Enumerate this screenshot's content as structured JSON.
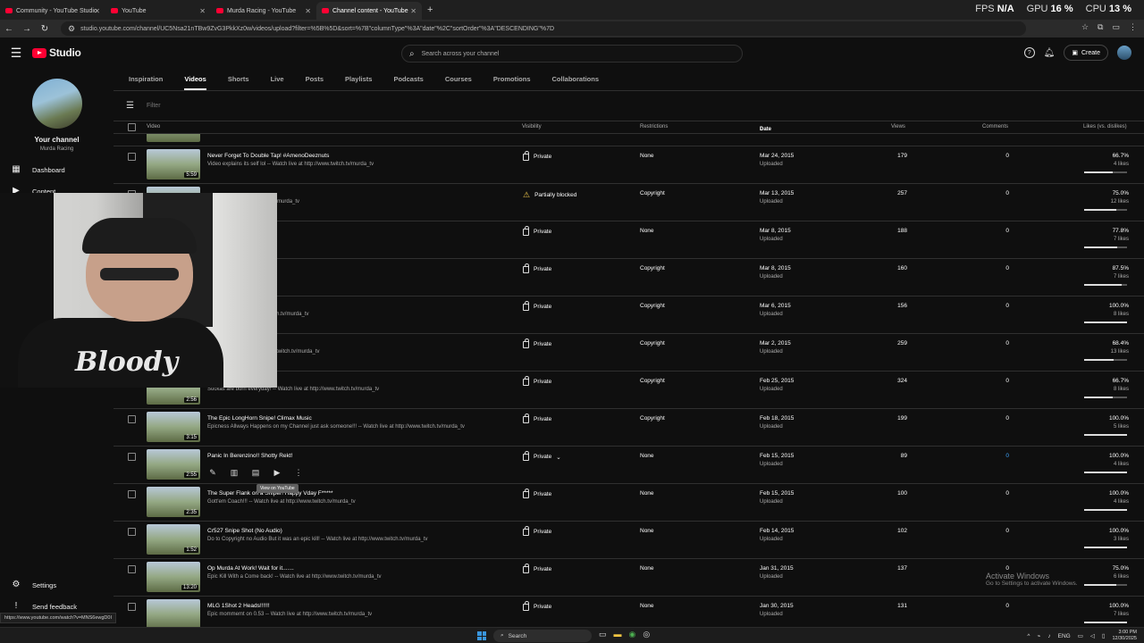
{
  "browser": {
    "tabs": [
      {
        "title": "Community - YouTube Studio"
      },
      {
        "title": "YouTube"
      },
      {
        "title": "Murda Racing - YouTube"
      },
      {
        "title": "Channel content - YouTube"
      }
    ],
    "url": "studio.youtube.com/channel/UC5Nsa21nTBw9ZvG3PkkXz0w/videos/upload?filter=%5B%5D&sort=%7B\"columnType\"%3A\"date\"%2C\"sortOrder\"%3A\"DESCENDING\"%7D",
    "perf": {
      "fps_label": "FPS",
      "fps_value": "N/A",
      "gpu_label": "GPU",
      "gpu_value": "16 %",
      "cpu_label": "CPU",
      "cpu_value": "13 %"
    }
  },
  "header": {
    "logo_text": "Studio",
    "search_placeholder": "Search across your channel",
    "create_label": "Create"
  },
  "sidebar": {
    "channel_title": "Your channel",
    "channel_name": "Murda Racing",
    "items": [
      {
        "label": "Dashboard",
        "icon": "dashboard-icon"
      },
      {
        "label": "Content",
        "icon": "content-icon"
      },
      {
        "label": "Settings",
        "icon": "gear-icon"
      },
      {
        "label": "Send feedback",
        "icon": "feedback-icon"
      }
    ]
  },
  "tabs": [
    "Inspiration",
    "Videos",
    "Shorts",
    "Live",
    "Posts",
    "Playlists",
    "Podcasts",
    "Courses",
    "Promotions",
    "Collaborations"
  ],
  "active_tab": "Videos",
  "filter_placeholder": "Filter",
  "columns": {
    "video": "Video",
    "visibility": "Visibility",
    "restrictions": "Restrictions",
    "date": "Date",
    "views": "Views",
    "comments": "Comments",
    "likes": "Likes (vs. dislikes)"
  },
  "videos": [
    {
      "title": "Never Forget To Double Tap! #AmenoDeeznuts",
      "desc": "Video explains its self lol -- Watch live at http://www.twitch.tv/murda_tv",
      "duration": "5:59",
      "visibility": "Private",
      "restrictions": "None",
      "date": "Mar 24, 2015",
      "status": "Uploaded",
      "views": "179",
      "comments": "0",
      "likes_pct": "66.7%",
      "likes_count": "4 likes",
      "like_ratio": 0.667
    },
    {
      "title": "",
      "desc": "ch live at http://www.twitch.tv/murda_tv",
      "duration": "",
      "visibility": "Partially blocked",
      "restrictions": "Copyright",
      "date": "Mar 13, 2015",
      "status": "Uploaded",
      "views": "257",
      "comments": "0",
      "likes_pct": "75.0%",
      "likes_count": "12 likes",
      "like_ratio": 0.75
    },
    {
      "title": "",
      "desc": "http://www.twitch.tv/murda_tv",
      "duration": "",
      "visibility": "Private",
      "restrictions": "None",
      "date": "Mar 8, 2015",
      "status": "Uploaded",
      "views": "188",
      "comments": "0",
      "likes_pct": "77.8%",
      "likes_count": "7 likes",
      "like_ratio": 0.778
    },
    {
      "title": "dat M4!",
      "desc": "ttp://www.twitch.tv/murda_tv",
      "duration": "",
      "visibility": "Private",
      "restrictions": "Copyright",
      "date": "Mar 8, 2015",
      "status": "Uploaded",
      "views": "160",
      "comments": "0",
      "likes_pct": "87.5%",
      "likes_count": "7 likes",
      "like_ratio": 0.875
    },
    {
      "title": "",
      "desc": "Watch live at http://www.twitch.tv/murda_tv",
      "duration": "",
      "visibility": "Private",
      "restrictions": "Copyright",
      "date": "Mar 6, 2015",
      "status": "Uploaded",
      "views": "156",
      "comments": "0",
      "likes_pct": "100.0%",
      "likes_count": "8 likes",
      "like_ratio": 1.0
    },
    {
      "title": "r Die!",
      "desc": "al -- Watch live at http://www.twitch.tv/murda_tv",
      "duration": "",
      "visibility": "Private",
      "restrictions": "Copyright",
      "date": "Mar 2, 2015",
      "status": "Uploaded",
      "views": "259",
      "comments": "0",
      "likes_pct": "68.4%",
      "likes_count": "13 likes",
      "like_ratio": 0.684
    },
    {
      "title": "",
      "desc": "Suckas are born everyday! -- Watch live at http://www.twitch.tv/murda_tv",
      "duration": "2:56",
      "visibility": "Private",
      "restrictions": "Copyright",
      "date": "Feb 25, 2015",
      "status": "Uploaded",
      "views": "324",
      "comments": "0",
      "likes_pct": "66.7%",
      "likes_count": "8 likes",
      "like_ratio": 0.667
    },
    {
      "title": "The Epic LongHorn Snipe! Climax Music",
      "desc": "Epicness Allways Happens on my Channel just ask someone!!! -- Watch live at http://www.twitch.tv/murda_tv",
      "duration": "3:15",
      "visibility": "Private",
      "restrictions": "Copyright",
      "date": "Feb 18, 2015",
      "status": "Uploaded",
      "views": "199",
      "comments": "0",
      "likes_pct": "100.0%",
      "likes_count": "5 likes",
      "like_ratio": 1.0
    },
    {
      "title": "Panic In Berenzino!! Shotty Rekt!",
      "desc": "",
      "duration": "2:55",
      "visibility": "Private",
      "restrictions": "None",
      "date": "Feb 15, 2015",
      "status": "Uploaded",
      "views": "89",
      "comments": "0",
      "likes_pct": "100.0%",
      "likes_count": "4 likes",
      "like_ratio": 1.0,
      "hovered": true
    },
    {
      "title": "The Super Flank on a Sniper! Happy Vday F*****",
      "desc": "Gott'em Coach!!! -- Watch live at http://www.twitch.tv/murda_tv",
      "duration": "2:35",
      "visibility": "Private",
      "restrictions": "None",
      "date": "Feb 15, 2015",
      "status": "Uploaded",
      "views": "100",
      "comments": "0",
      "likes_pct": "100.0%",
      "likes_count": "4 likes",
      "like_ratio": 1.0
    },
    {
      "title": "Cr527 Snipe Shot (No Audio)",
      "desc": "Do to Copyright no Audio But it was an epic kill! -- Watch live at http://www.twitch.tv/murda_tv",
      "duration": "1:52",
      "visibility": "Private",
      "restrictions": "None",
      "date": "Feb 14, 2015",
      "status": "Uploaded",
      "views": "102",
      "comments": "0",
      "likes_pct": "100.0%",
      "likes_count": "3 likes",
      "like_ratio": 1.0
    },
    {
      "title": "Op Murda At Work! Wait for it.......",
      "desc": "Epic Kill With a Come back! -- Watch live at http://www.twitch.tv/murda_tv",
      "duration": "13:20",
      "visibility": "Private",
      "restrictions": "None",
      "date": "Jan 31, 2015",
      "status": "Uploaded",
      "views": "137",
      "comments": "0",
      "likes_pct": "75.0%",
      "likes_count": "6 likes",
      "like_ratio": 0.75
    },
    {
      "title": "MLG 1Shot 2 Heads!!!!!!",
      "desc": "Epic mommemt on 0.53 -- Watch live at http://www.twitch.tv/murda_tv",
      "duration": "",
      "visibility": "Private",
      "restrictions": "None",
      "date": "Jan 30, 2015",
      "status": "Uploaded",
      "views": "131",
      "comments": "0",
      "likes_pct": "100.0%",
      "likes_count": "7 likes",
      "like_ratio": 1.0
    }
  ],
  "tooltip": "View on YouTube",
  "activate": {
    "line1": "Activate Windows",
    "line2": "Go to Settings to activate Windows."
  },
  "status_link": "https://www.youtube.com/watch?v=MNS6ewgD0I",
  "taskbar": {
    "search": "Search",
    "lang": "ENG",
    "time": "3:00 PM",
    "date": "12/30/2025"
  },
  "webcam_shirt_text": "Bloody"
}
